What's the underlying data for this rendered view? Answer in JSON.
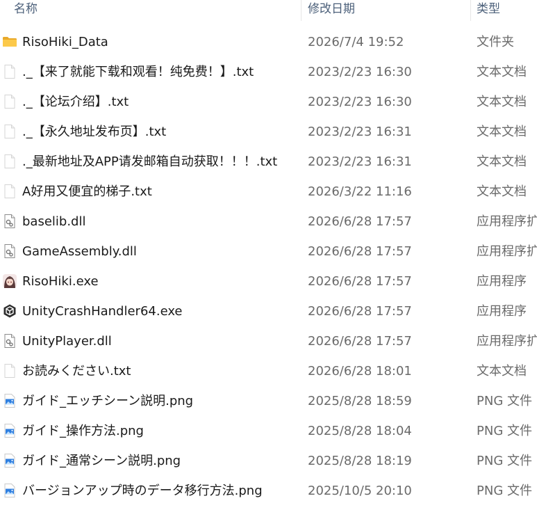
{
  "columns": {
    "name": "名称",
    "date": "修改日期",
    "type": "类型"
  },
  "files": [
    {
      "name": "RisoHiki_Data",
      "date": "2026/7/4 19:52",
      "type": "文件夹",
      "icon": "folder"
    },
    {
      "name": "._【来了就能下载和观看！纯免费！】.txt",
      "date": "2023/2/23 16:30",
      "type": "文本文档",
      "icon": "text"
    },
    {
      "name": "._【论坛介绍】.txt",
      "date": "2023/2/23 16:30",
      "type": "文本文档",
      "icon": "text"
    },
    {
      "name": "._【永久地址发布页】.txt",
      "date": "2023/2/23 16:31",
      "type": "文本文档",
      "icon": "text"
    },
    {
      "name": "._最新地址及APP请发邮箱自动获取！！！.txt",
      "date": "2023/2/23 16:31",
      "type": "文本文档",
      "icon": "text"
    },
    {
      "name": "A好用又便宜的梯子.txt",
      "date": "2026/3/22 11:16",
      "type": "文本文档",
      "icon": "text"
    },
    {
      "name": "baselib.dll",
      "date": "2026/6/28 17:57",
      "type": "应用程序扩",
      "icon": "dll"
    },
    {
      "name": "GameAssembly.dll",
      "date": "2026/6/28 17:57",
      "type": "应用程序扩",
      "icon": "dll"
    },
    {
      "name": "RisoHiki.exe",
      "date": "2026/6/28 17:57",
      "type": "应用程序",
      "icon": "app-avatar"
    },
    {
      "name": "UnityCrashHandler64.exe",
      "date": "2026/6/28 17:57",
      "type": "应用程序",
      "icon": "unity"
    },
    {
      "name": "UnityPlayer.dll",
      "date": "2026/6/28 17:57",
      "type": "应用程序扩",
      "icon": "dll"
    },
    {
      "name": "お読みください.txt",
      "date": "2026/6/28 18:01",
      "type": "文本文档",
      "icon": "text"
    },
    {
      "name": "ガイド_エッチシーン説明.png",
      "date": "2025/8/28 18:59",
      "type": "PNG 文件",
      "icon": "image"
    },
    {
      "name": "ガイド_操作方法.png",
      "date": "2025/8/28 18:04",
      "type": "PNG 文件",
      "icon": "image"
    },
    {
      "name": "ガイド_通常シーン説明.png",
      "date": "2025/8/28 18:19",
      "type": "PNG 文件",
      "icon": "image"
    },
    {
      "name": "バージョンアップ時のデータ移行方法.png",
      "date": "2025/10/5 20:10",
      "type": "PNG 文件",
      "icon": "image"
    }
  ]
}
